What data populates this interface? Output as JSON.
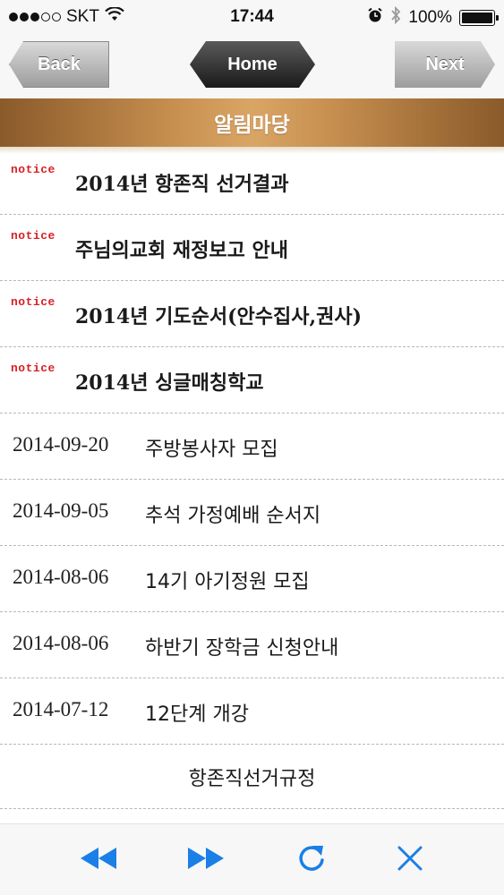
{
  "status_bar": {
    "carrier": "SKT",
    "time": "17:44",
    "battery": "100%",
    "battery_level": 1.0,
    "signal_bars": 3,
    "signal_total": 5
  },
  "nav": {
    "back_label": "Back",
    "home_label": "Home",
    "next_label": "Next"
  },
  "header": {
    "title": "알림마당"
  },
  "notices": [
    {
      "tag": "notice",
      "title": "2014년 항존직 선거결과"
    },
    {
      "tag": "notice",
      "title": "주님의교회 재정보고 안내"
    },
    {
      "tag": "notice",
      "title": "2014년 기도순서(안수집사,권사)"
    },
    {
      "tag": "notice",
      "title": "2014년 싱글매칭학교"
    }
  ],
  "posts": [
    {
      "date": "2014-09-20",
      "title": "주방봉사자 모집"
    },
    {
      "date": "2014-09-05",
      "title": "추석 가정예배 순서지"
    },
    {
      "date": "2014-08-06",
      "title": "14기 아기정원 모집"
    },
    {
      "date": "2014-08-06",
      "title": "하반기 장학금 신청안내"
    },
    {
      "date": "2014-07-12",
      "title": "12단계 개강"
    }
  ],
  "footer_link": "항존직선거규정",
  "toolbar": {
    "rewind_icon": "rewind-icon",
    "fast_forward_icon": "fast-forward-icon",
    "refresh_icon": "refresh-icon",
    "close_icon": "close-icon"
  },
  "colors": {
    "notice_tag": "#d81f26",
    "title_bar": "#c89050",
    "toolbar_icons": "#1a7fe6"
  }
}
